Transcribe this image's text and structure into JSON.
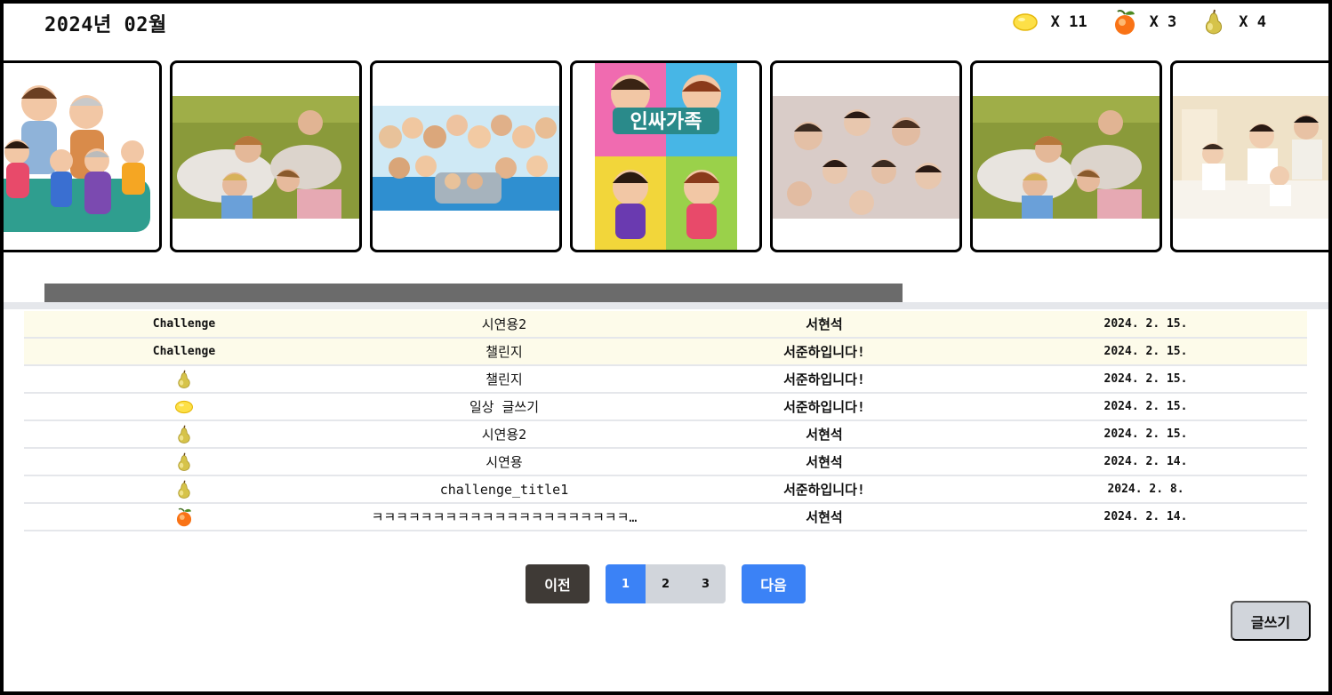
{
  "header": {
    "month": "2024년 02월",
    "counters": [
      {
        "icon": "lemon-icon",
        "label": "X 11"
      },
      {
        "icon": "peach-icon",
        "label": "X 3"
      },
      {
        "icon": "pear-icon",
        "label": "X 4"
      }
    ]
  },
  "carousel": {
    "cards": [
      {
        "image": "family-cartoon-sofa"
      },
      {
        "image": "family-lying-on-grass"
      },
      {
        "image": "cartoon-crowd-group"
      },
      {
        "image": "comic-book-cover",
        "text": "인싸가족"
      },
      {
        "image": "family-lying-circle"
      },
      {
        "image": "family-lying-on-grass"
      },
      {
        "image": "family-on-bed"
      }
    ]
  },
  "table": {
    "rows": [
      {
        "type": "Challenge",
        "title": "시연용2",
        "author": "서현석",
        "date": "2024. 2. 15.",
        "highlight": true
      },
      {
        "type": "Challenge",
        "title": "챌린지",
        "author": "서준하입니다!",
        "date": "2024. 2. 15.",
        "highlight": true
      },
      {
        "type": "pear-icon",
        "title": "챌린지",
        "author": "서준하입니다!",
        "date": "2024. 2. 15."
      },
      {
        "type": "lemon-icon",
        "title": "일상 글쓰기",
        "author": "서준하입니다!",
        "date": "2024. 2. 15."
      },
      {
        "type": "pear-icon",
        "title": "시연용2",
        "author": "서현석",
        "date": "2024. 2. 15."
      },
      {
        "type": "pear-icon",
        "title": "시연용",
        "author": "서현석",
        "date": "2024. 2. 14."
      },
      {
        "type": "pear-icon",
        "title": "challenge_title1",
        "author": "서준하입니다!",
        "date": "2024. 2. 8."
      },
      {
        "type": "peach-icon",
        "title": "ㅋㅋㅋㅋㅋㅋㅋㅋㅋㅋㅋㅋㅋㅋㅋㅋㅋㅋㅋㅋㅋ…",
        "author": "서현석",
        "date": "2024. 2. 14."
      }
    ]
  },
  "pagination": {
    "prev_label": "이전",
    "pages": [
      "1",
      "2",
      "3"
    ],
    "current": "1",
    "next_label": "다음"
  },
  "write_label": "글쓰기",
  "colors": {
    "accent": "#3b82f6",
    "dark_button": "#3f3a36",
    "highlight_row": "#fdfbea"
  }
}
